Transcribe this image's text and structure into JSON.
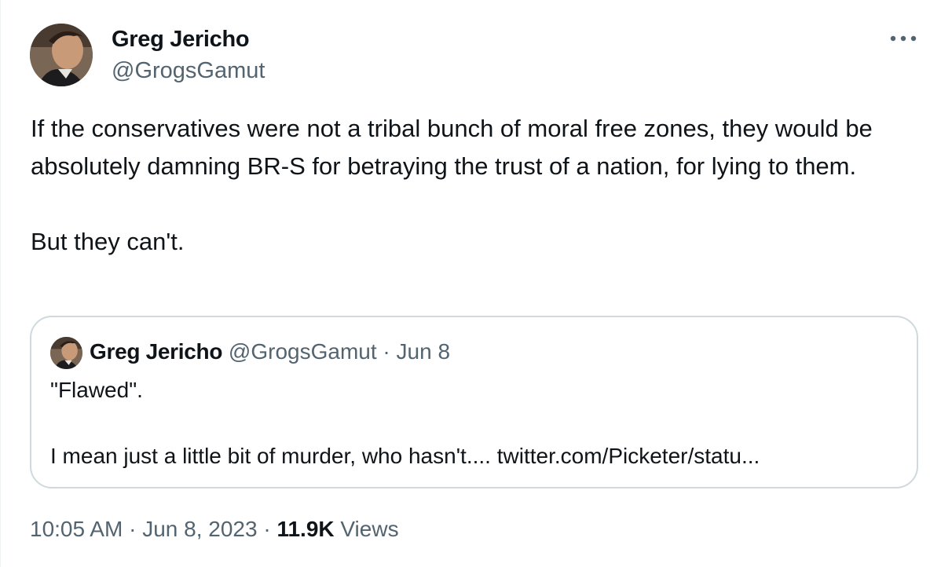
{
  "author": {
    "name": "Greg Jericho",
    "handle": "@GrogsGamut"
  },
  "menu": {
    "icon": "more-dots-icon"
  },
  "tweet": {
    "paragraph_1": "If the conservatives were not a tribal bunch of moral free zones, they would be absolutely damning BR-S for betraying the trust of a nation, for lying to them.",
    "paragraph_2": "But they can't."
  },
  "quote": {
    "name": "Greg Jericho",
    "handle": "@GrogsGamut",
    "separator": " · ",
    "date": "Jun 8",
    "paragraph_1": "\"Flawed\".",
    "paragraph_2_text": "I mean just a little bit of murder, who hasn't.... ",
    "link": "twitter.com/Picketer/statu..."
  },
  "footer": {
    "time": "10:05 AM",
    "date": "Jun 8, 2023",
    "separator": " · ",
    "views_count": "11.9K",
    "views_label": "Views"
  },
  "colors": {
    "text_primary": "#0f1419",
    "text_secondary": "#536471",
    "border": "#cfd9de"
  }
}
